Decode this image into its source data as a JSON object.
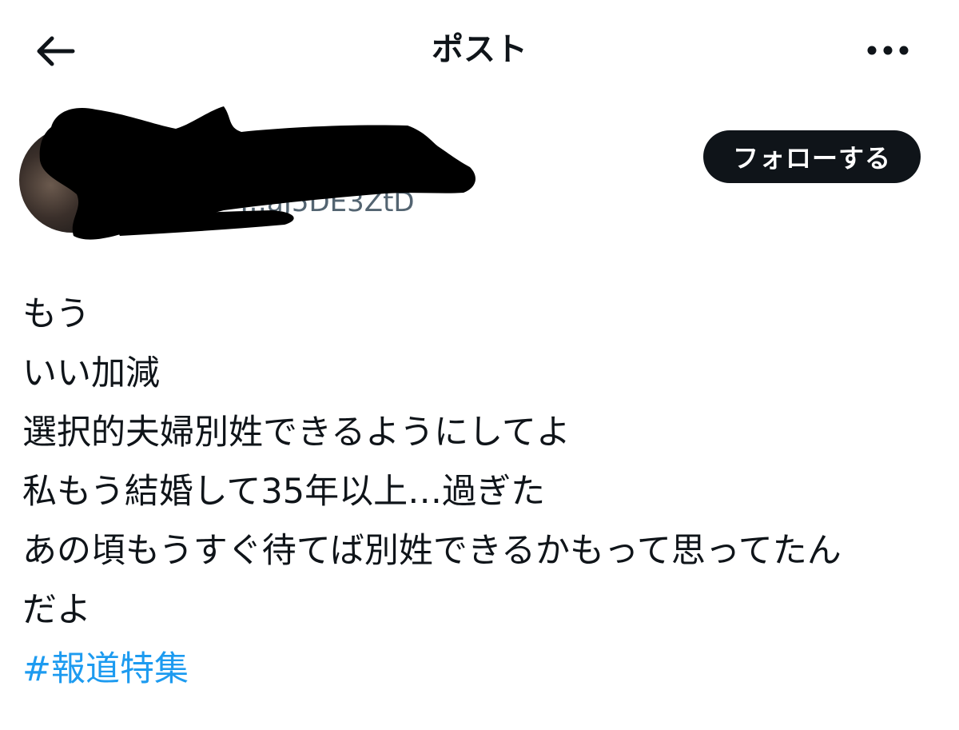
{
  "header": {
    "title": "ポスト",
    "back_icon": "arrow-left-icon",
    "more_icon": "ellipsis-icon"
  },
  "author": {
    "handle_fragment": "…aJ5DE3ZtD",
    "follow_label": "フォローする"
  },
  "post": {
    "lines": [
      "もう",
      "いい加減",
      "選択的夫婦別姓できるようにしてよ",
      "私もう結婚して35年以上…過ぎた",
      "あの頃もうすぐ待てば別姓できるかもって思ってたん",
      "だよ"
    ],
    "hashtag": "#報道特集"
  },
  "colors": {
    "text": "#0f1419",
    "link": "#1d9bf0",
    "button_bg": "#0f1419",
    "button_text": "#ffffff",
    "secondary_text": "#536471"
  }
}
